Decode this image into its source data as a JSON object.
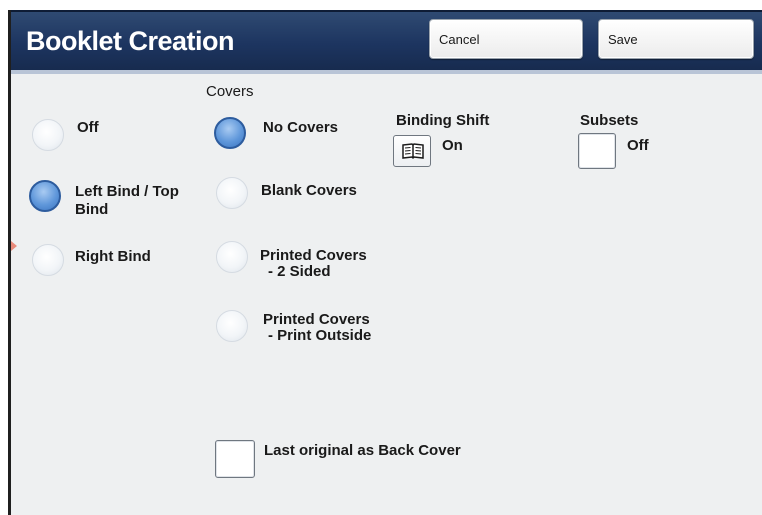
{
  "header": {
    "title": "Booklet Creation",
    "cancel_label": "Cancel",
    "save_label": "Save"
  },
  "binding": {
    "options": [
      {
        "label": "Off",
        "selected": false
      },
      {
        "label": "Left Bind / Top Bind",
        "line1": "Left Bind / Top",
        "line2": "Bind",
        "selected": true
      },
      {
        "label": "Right Bind",
        "selected": false
      }
    ]
  },
  "covers": {
    "heading": "Covers",
    "options": [
      {
        "label": "No Covers",
        "selected": true
      },
      {
        "label": "Blank Covers",
        "selected": false
      },
      {
        "label": "Printed Covers - 2 Sided",
        "line1": "Printed Covers",
        "line2": "- 2 Sided",
        "selected": false
      },
      {
        "label": "Printed Covers - Print Outside",
        "line1": "Printed Covers",
        "line2": "- Print Outside",
        "selected": false
      }
    ],
    "last_original_label": "Last original as Back Cover",
    "last_original_checked": false
  },
  "binding_shift": {
    "heading": "Binding Shift",
    "state": "On",
    "icon": "open-book-icon"
  },
  "subsets": {
    "heading": "Subsets",
    "state": "Off",
    "checked": false
  },
  "colors": {
    "header_bg": "#1d3560",
    "selected_radio": "#5f97da",
    "panel_bg": "#eef0f1"
  }
}
